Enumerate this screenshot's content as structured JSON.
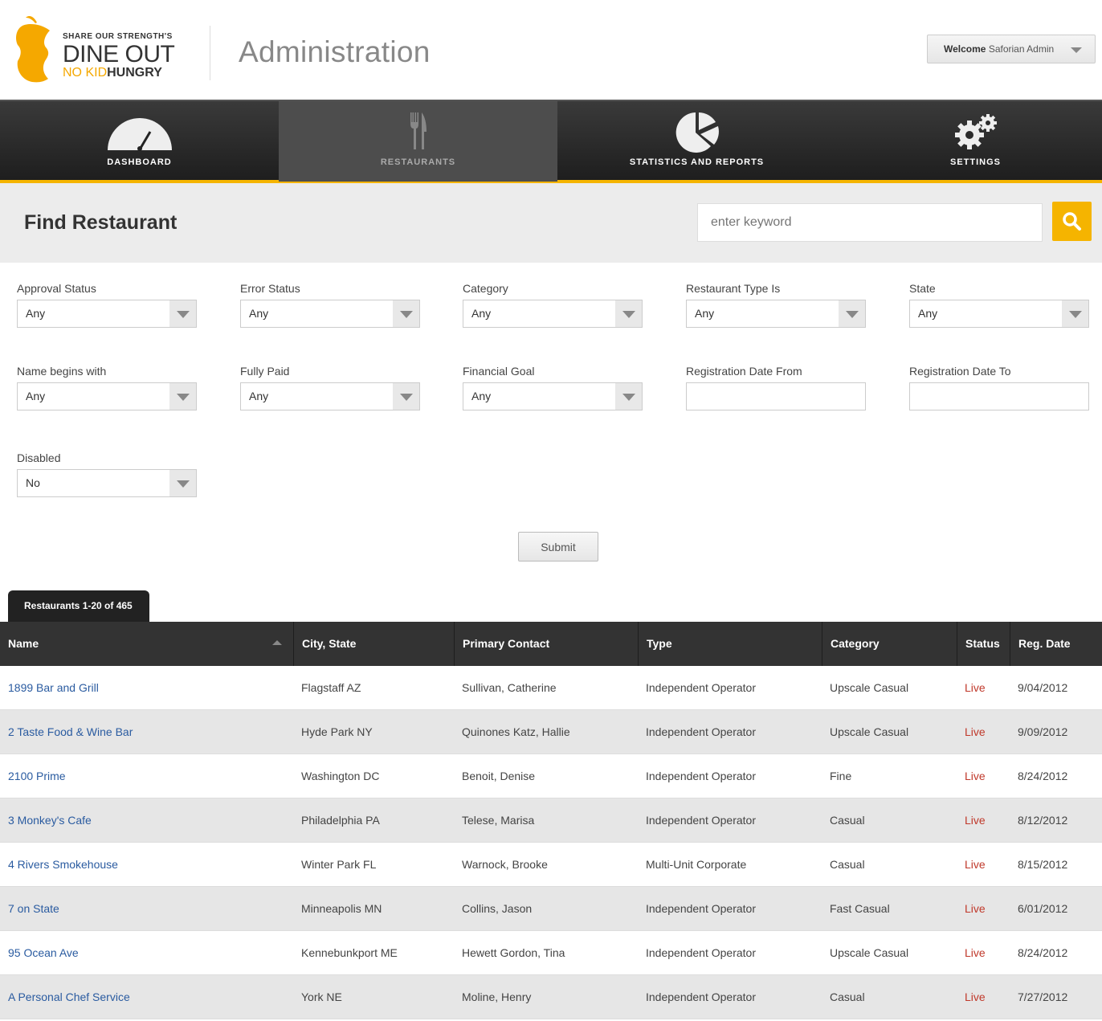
{
  "header": {
    "logo_line1": "SHARE OUR STRENGTH'S",
    "logo_line2": "DINE OUT",
    "logo_line3a": "NO KID",
    "logo_line3b": "HUNGRY",
    "title": "Administration",
    "welcome_prefix": "Welcome",
    "welcome_user": "Saforian Admin"
  },
  "nav": {
    "items": [
      {
        "label": "DASHBOARD",
        "icon": "gauge-icon"
      },
      {
        "label": "RESTAURANTS",
        "icon": "fork-knife-icon",
        "active": true
      },
      {
        "label": "STATISTICS AND REPORTS",
        "icon": "pie-chart-icon"
      },
      {
        "label": "SETTINGS",
        "icon": "gears-icon"
      }
    ]
  },
  "find": {
    "title": "Find Restaurant",
    "search_placeholder": "enter keyword"
  },
  "filters": {
    "approval_status": {
      "label": "Approval Status",
      "value": "Any"
    },
    "error_status": {
      "label": "Error Status",
      "value": "Any"
    },
    "category": {
      "label": "Category",
      "value": "Any"
    },
    "restaurant_type": {
      "label": "Restaurant Type Is",
      "value": "Any"
    },
    "state": {
      "label": "State",
      "value": "Any"
    },
    "name_begins": {
      "label": "Name begins with",
      "value": "Any"
    },
    "fully_paid": {
      "label": "Fully Paid",
      "value": "Any"
    },
    "financial_goal": {
      "label": "Financial Goal",
      "value": "Any"
    },
    "reg_date_from": {
      "label": "Registration Date From",
      "value": ""
    },
    "reg_date_to": {
      "label": "Registration Date To",
      "value": ""
    },
    "disabled": {
      "label": "Disabled",
      "value": "No"
    },
    "submit_label": "Submit"
  },
  "results": {
    "tab_label": "Restaurants 1-20 of 465",
    "columns": [
      "Name",
      "City, State",
      "Primary Contact",
      "Type",
      "Category",
      "Status",
      "Reg. Date"
    ],
    "rows": [
      {
        "name": "1899 Bar and Grill",
        "city": "Flagstaff AZ",
        "contact": "Sullivan, Catherine",
        "type": "Independent Operator",
        "category": "Upscale Casual",
        "status": "Live",
        "date": "9/04/2012"
      },
      {
        "name": "2 Taste Food & Wine Bar",
        "city": "Hyde Park NY",
        "contact": "Quinones Katz, Hallie",
        "type": "Independent Operator",
        "category": "Upscale Casual",
        "status": "Live",
        "date": "9/09/2012"
      },
      {
        "name": "2100 Prime",
        "city": "Washington DC",
        "contact": "Benoit, Denise",
        "type": "Independent Operator",
        "category": "Fine",
        "status": "Live",
        "date": "8/24/2012"
      },
      {
        "name": "3 Monkey's Cafe",
        "city": "Philadelphia PA",
        "contact": "Telese, Marisa",
        "type": "Independent Operator",
        "category": "Casual",
        "status": "Live",
        "date": "8/12/2012"
      },
      {
        "name": "4 Rivers Smokehouse",
        "city": "Winter Park FL",
        "contact": "Warnock, Brooke",
        "type": "Multi-Unit Corporate",
        "category": "Casual",
        "status": "Live",
        "date": "8/15/2012"
      },
      {
        "name": "7 on State",
        "city": "Minneapolis MN",
        "contact": "Collins, Jason",
        "type": "Independent Operator",
        "category": "Fast Casual",
        "status": "Live",
        "date": "6/01/2012"
      },
      {
        "name": "95 Ocean Ave",
        "city": "Kennebunkport ME",
        "contact": "Hewett Gordon, Tina",
        "type": "Independent Operator",
        "category": "Upscale Casual",
        "status": "Live",
        "date": "8/24/2012"
      },
      {
        "name": "A Personal Chef Service",
        "city": "York NE",
        "contact": "Moline, Henry",
        "type": "Independent Operator",
        "category": "Casual",
        "status": "Live",
        "date": "7/27/2012"
      }
    ]
  },
  "colors": {
    "accent": "#f5b400",
    "nav_bg": "#2b2b2b",
    "link": "#2a5ba0",
    "status_live": "#c0392b"
  }
}
